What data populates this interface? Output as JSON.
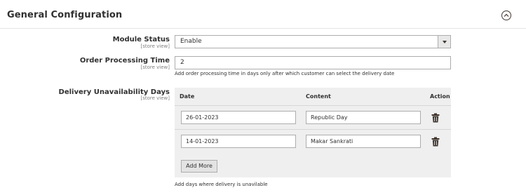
{
  "section": {
    "title": "General Configuration"
  },
  "fields": {
    "module_status": {
      "label": "Module Status",
      "scope": "[store view]",
      "value": "Enable"
    },
    "order_processing_time": {
      "label": "Order Processing Time",
      "scope": "[store view]",
      "value": "2",
      "note": "Add order processing time in days only after which customer can select the delivery date"
    },
    "delivery_unavailability": {
      "label": "Delivery Unavailability Days",
      "scope": "[store view]",
      "columns": {
        "date": "Date",
        "content": "Content",
        "action": "Action"
      },
      "rows": [
        {
          "date": "26-01-2023",
          "content": "Republic Day"
        },
        {
          "date": "14-01-2023",
          "content": "Makar Sankrati"
        }
      ],
      "add_more_label": "Add More",
      "note": "Add days where delivery is unavilable"
    }
  },
  "icons": {
    "collapse": "chevron-up-circle-icon",
    "dropdown": "caret-down-icon",
    "delete": "trash-icon"
  }
}
